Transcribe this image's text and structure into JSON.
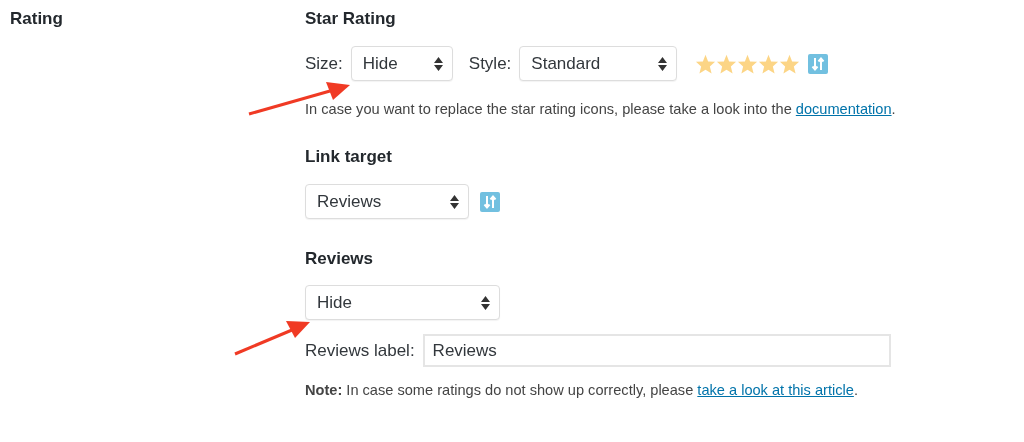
{
  "section_label": "Rating",
  "star_rating": {
    "heading": "Star Rating",
    "size": {
      "label": "Size:",
      "value": "Hide"
    },
    "style": {
      "label": "Style:",
      "value": "Standard"
    },
    "preview": {
      "stars": 5
    },
    "help": {
      "before": "In case you want to replace the star rating icons, please take a look into the ",
      "link": "documentation",
      "after": "."
    }
  },
  "link_target": {
    "heading": "Link target",
    "value": "Reviews"
  },
  "reviews": {
    "heading": "Reviews",
    "value": "Hide",
    "label_field": {
      "label": "Reviews label:",
      "value": "Reviews"
    },
    "note": {
      "text": "**Note:** In case some ratings do not show up correctly, please ",
      "link": "take a look at this article",
      "after": "."
    }
  }
}
